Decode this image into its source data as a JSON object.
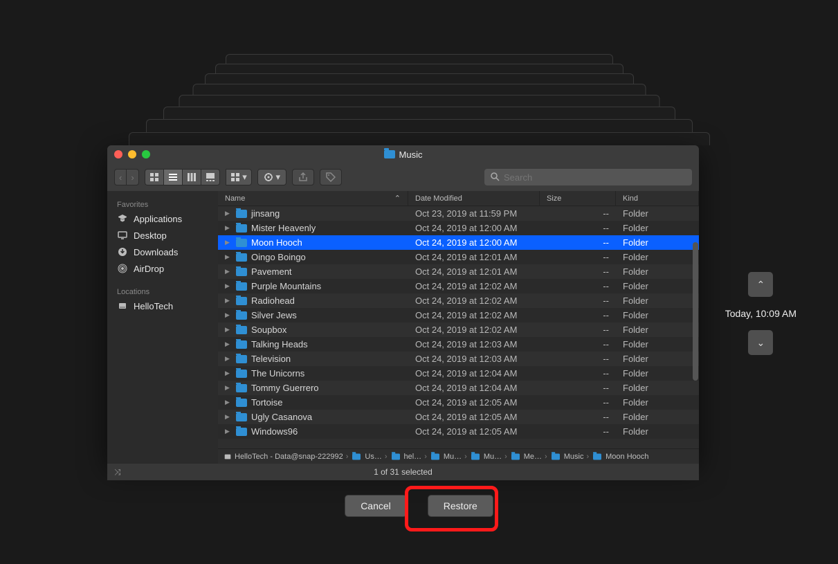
{
  "window": {
    "title": "Music"
  },
  "toolbar": {
    "search_placeholder": "Search"
  },
  "sidebar": {
    "favorites_label": "Favorites",
    "locations_label": "Locations",
    "favorites": [
      {
        "label": "Applications",
        "icon": "apps-icon"
      },
      {
        "label": "Desktop",
        "icon": "desktop-icon"
      },
      {
        "label": "Downloads",
        "icon": "downloads-icon"
      },
      {
        "label": "AirDrop",
        "icon": "airdrop-icon"
      }
    ],
    "locations": [
      {
        "label": "HelloTech",
        "icon": "disk-icon"
      }
    ]
  },
  "columns": {
    "name": "Name",
    "date": "Date Modified",
    "size": "Size",
    "kind": "Kind"
  },
  "files": [
    {
      "name": "jinsang",
      "date": "Oct 23, 2019 at 11:59 PM",
      "size": "--",
      "kind": "Folder",
      "selected": false
    },
    {
      "name": "Mister Heavenly",
      "date": "Oct 24, 2019 at 12:00 AM",
      "size": "--",
      "kind": "Folder",
      "selected": false
    },
    {
      "name": "Moon Hooch",
      "date": "Oct 24, 2019 at 12:00 AM",
      "size": "--",
      "kind": "Folder",
      "selected": true
    },
    {
      "name": "Oingo Boingo",
      "date": "Oct 24, 2019 at 12:01 AM",
      "size": "--",
      "kind": "Folder",
      "selected": false
    },
    {
      "name": "Pavement",
      "date": "Oct 24, 2019 at 12:01 AM",
      "size": "--",
      "kind": "Folder",
      "selected": false
    },
    {
      "name": "Purple Mountains",
      "date": "Oct 24, 2019 at 12:02 AM",
      "size": "--",
      "kind": "Folder",
      "selected": false
    },
    {
      "name": "Radiohead",
      "date": "Oct 24, 2019 at 12:02 AM",
      "size": "--",
      "kind": "Folder",
      "selected": false
    },
    {
      "name": "Silver Jews",
      "date": "Oct 24, 2019 at 12:02 AM",
      "size": "--",
      "kind": "Folder",
      "selected": false
    },
    {
      "name": "Soupbox",
      "date": "Oct 24, 2019 at 12:02 AM",
      "size": "--",
      "kind": "Folder",
      "selected": false
    },
    {
      "name": "Talking Heads",
      "date": "Oct 24, 2019 at 12:03 AM",
      "size": "--",
      "kind": "Folder",
      "selected": false
    },
    {
      "name": "Television",
      "date": "Oct 24, 2019 at 12:03 AM",
      "size": "--",
      "kind": "Folder",
      "selected": false
    },
    {
      "name": "The Unicorns",
      "date": "Oct 24, 2019 at 12:04 AM",
      "size": "--",
      "kind": "Folder",
      "selected": false
    },
    {
      "name": "Tommy Guerrero",
      "date": "Oct 24, 2019 at 12:04 AM",
      "size": "--",
      "kind": "Folder",
      "selected": false
    },
    {
      "name": "Tortoise",
      "date": "Oct 24, 2019 at 12:05 AM",
      "size": "--",
      "kind": "Folder",
      "selected": false
    },
    {
      "name": "Ugly Casanova",
      "date": "Oct 24, 2019 at 12:05 AM",
      "size": "--",
      "kind": "Folder",
      "selected": false
    },
    {
      "name": "Windows96",
      "date": "Oct 24, 2019 at 12:05 AM",
      "size": "--",
      "kind": "Folder",
      "selected": false
    }
  ],
  "path": [
    "HelloTech - Data@snap-222992",
    "Us…",
    "hel…",
    "Mu…",
    "Mu…",
    "Me…",
    "Music",
    "Moon Hooch"
  ],
  "status": "1 of 31 selected",
  "buttons": {
    "cancel": "Cancel",
    "restore": "Restore"
  },
  "timeline": {
    "label": "Today, 10:09 AM"
  }
}
